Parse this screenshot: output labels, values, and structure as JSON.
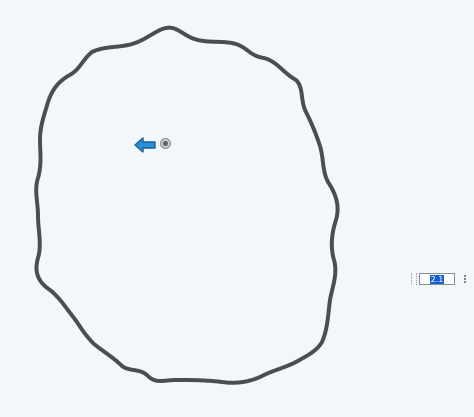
{
  "canvas": {
    "background_color": "#f2f7fb",
    "stroke_color": "#4a4e52"
  },
  "arrow": {
    "icon": "arrow-left-icon",
    "fill_color": "#2a8fd6",
    "outline_color": "#1d5f93"
  },
  "marker": {
    "icon": "target-icon"
  },
  "value_field": {
    "value": "2.1",
    "selection_color": "#1a5fcf"
  }
}
